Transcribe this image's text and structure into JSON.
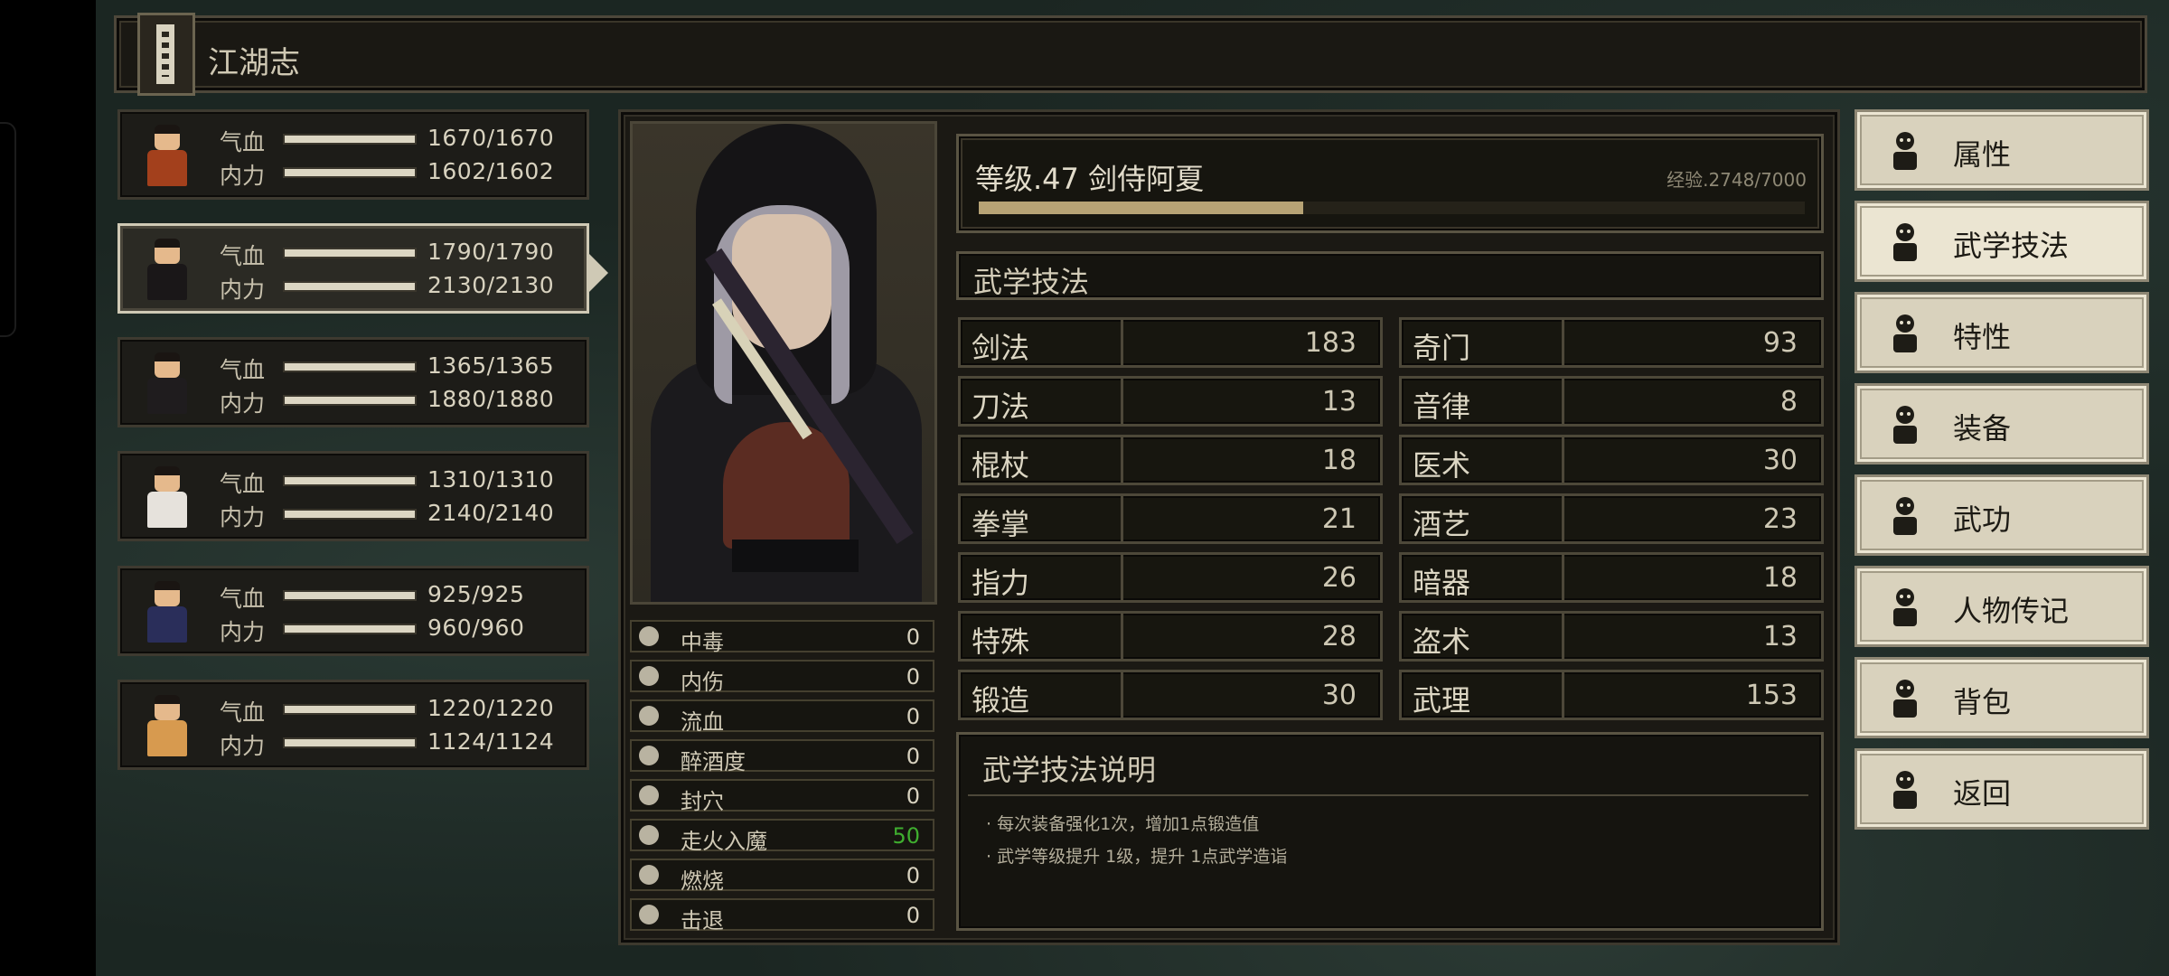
{
  "header": {
    "title": "江湖志",
    "icon": "scroll-book-icon"
  },
  "party": [
    {
      "hp_label": "气血",
      "hp": "1670/1670",
      "hp_frac": 1.0,
      "mp_label": "内力",
      "mp": "1602/1602",
      "mp_frac": 1.0,
      "robe": "#a3401c",
      "selected": false
    },
    {
      "hp_label": "气血",
      "hp": "1790/1790",
      "hp_frac": 1.0,
      "mp_label": "内力",
      "mp": "2130/2130",
      "mp_frac": 1.0,
      "robe": "#1a1718",
      "selected": true
    },
    {
      "hp_label": "气血",
      "hp": "1365/1365",
      "hp_frac": 1.0,
      "mp_label": "内力",
      "mp": "1880/1880",
      "mp_frac": 1.0,
      "robe": "#1f1c1e",
      "selected": false
    },
    {
      "hp_label": "气血",
      "hp": "1310/1310",
      "hp_frac": 1.0,
      "mp_label": "内力",
      "mp": "2140/2140",
      "mp_frac": 1.0,
      "robe": "#e6e2dc",
      "selected": false
    },
    {
      "hp_label": "气血",
      "hp": "925/925",
      "hp_frac": 1.0,
      "mp_label": "内力",
      "mp": "960/960",
      "mp_frac": 1.0,
      "robe": "#2a2e5a",
      "selected": false
    },
    {
      "hp_label": "气血",
      "hp": "1220/1220",
      "hp_frac": 1.0,
      "mp_label": "内力",
      "mp": "1124/1124",
      "mp_frac": 1.0,
      "robe": "#d79a4f",
      "selected": false
    }
  ],
  "status": [
    {
      "label": "中毒",
      "value": "0",
      "icon": "skull-icon"
    },
    {
      "label": "内伤",
      "value": "0",
      "icon": "broken-heart-icon"
    },
    {
      "label": "流血",
      "value": "0",
      "icon": "blood-splat-icon"
    },
    {
      "label": "醉酒度",
      "value": "0",
      "icon": "drunk-face-icon"
    },
    {
      "label": "封穴",
      "value": "0",
      "icon": "acupoint-icon"
    },
    {
      "label": "走火入魔",
      "value": "50",
      "icon": "demon-face-icon",
      "color": "#3fae2f"
    },
    {
      "label": "燃烧",
      "value": "0",
      "icon": "flame-icon"
    },
    {
      "label": "击退",
      "value": "0",
      "icon": "boot-icon"
    }
  ],
  "character": {
    "level_title": "等级.47 剑侍阿夏",
    "exp_text": "经验.2748/7000",
    "exp_frac": 0.3926
  },
  "skills_section": {
    "title": "武学技法"
  },
  "skills": [
    {
      "name": "剑法",
      "value": "183"
    },
    {
      "name": "奇门",
      "value": "93"
    },
    {
      "name": "刀法",
      "value": "13"
    },
    {
      "name": "音律",
      "value": "8"
    },
    {
      "name": "棍杖",
      "value": "18"
    },
    {
      "name": "医术",
      "value": "30"
    },
    {
      "name": "拳掌",
      "value": "21"
    },
    {
      "name": "酒艺",
      "value": "23"
    },
    {
      "name": "指力",
      "value": "26"
    },
    {
      "name": "暗器",
      "value": "18"
    },
    {
      "name": "特殊",
      "value": "28"
    },
    {
      "name": "盗术",
      "value": "13"
    },
    {
      "name": "锻造",
      "value": "30"
    },
    {
      "name": "武理",
      "value": "153"
    }
  ],
  "description": {
    "title": "武学技法说明",
    "lines": [
      "· 每次装备强化1次，增加1点锻造值",
      "· 武学等级提升 1级，提升 1点武学造诣"
    ]
  },
  "menu": [
    {
      "label": "属性",
      "icon": "character-icon",
      "active": false
    },
    {
      "label": "武学技法",
      "icon": "martial-figure-icon",
      "active": true
    },
    {
      "label": "特性",
      "icon": "trait-figure-icon",
      "active": false
    },
    {
      "label": "装备",
      "icon": "sword-icon",
      "active": false
    },
    {
      "label": "武功",
      "icon": "manual-book-icon",
      "active": false
    },
    {
      "label": "人物传记",
      "icon": "scroll-icon",
      "active": false
    },
    {
      "label": "背包",
      "icon": "bag-icon",
      "active": false
    },
    {
      "label": "返回",
      "icon": "door-icon",
      "active": false
    }
  ]
}
